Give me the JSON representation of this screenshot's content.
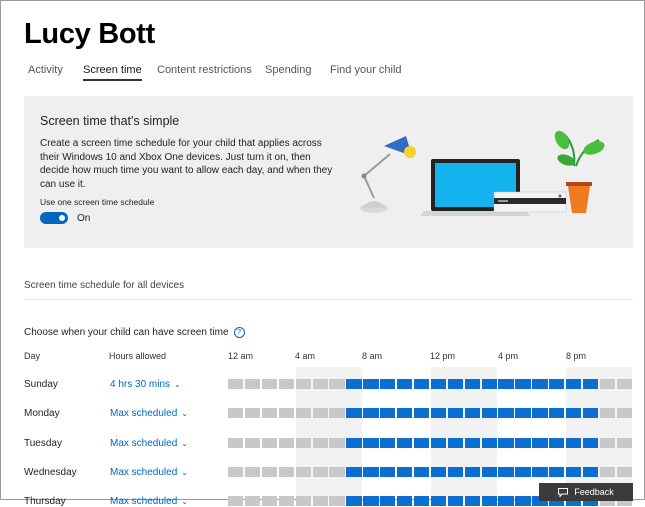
{
  "page": {
    "title": "Lucy Bott"
  },
  "tabs": [
    {
      "label": "Activity"
    },
    {
      "label": "Screen time"
    },
    {
      "label": "Content restrictions"
    },
    {
      "label": "Spending"
    },
    {
      "label": "Find your child"
    }
  ],
  "active_tab": "Screen time",
  "promo": {
    "title": "Screen time that's simple",
    "body": "Create a screen time schedule for your child that applies across their Windows 10 and Xbox One devices. Just turn it on, then decide how much time you want to allow each day, and when they can use it.",
    "switch_label": "Use one screen time schedule",
    "switch_state": "On",
    "switch_on": true
  },
  "schedule": {
    "subtitle": "Screen time schedule for all devices",
    "choose": "Choose when your child can have screen time",
    "help_glyph": "?",
    "col_day": "Day",
    "col_hours": "Hours allowed",
    "hour_labels": [
      "12 am",
      "4 am",
      "8 am",
      "12 pm",
      "4 pm",
      "8 pm"
    ],
    "rows": [
      {
        "day": "Sunday",
        "hours": "4 hrs 30 mins"
      },
      {
        "day": "Monday",
        "hours": "Max scheduled"
      },
      {
        "day": "Tuesday",
        "hours": "Max scheduled"
      },
      {
        "day": "Wednesday",
        "hours": "Max scheduled"
      },
      {
        "day": "Thursday",
        "hours": "Max scheduled"
      }
    ],
    "allowed_start_hour": 7,
    "allowed_end_hour": 22,
    "chevron": "⌄"
  },
  "feedback": {
    "label": "Feedback",
    "icon": "chat-bubble-icon"
  },
  "colors": {
    "accent": "#0067c0",
    "allowed": "#0a6fd1",
    "blocked": "#c8c8c8",
    "promo_bg": "#efefef",
    "feedback_bg": "#3b3b3b"
  }
}
